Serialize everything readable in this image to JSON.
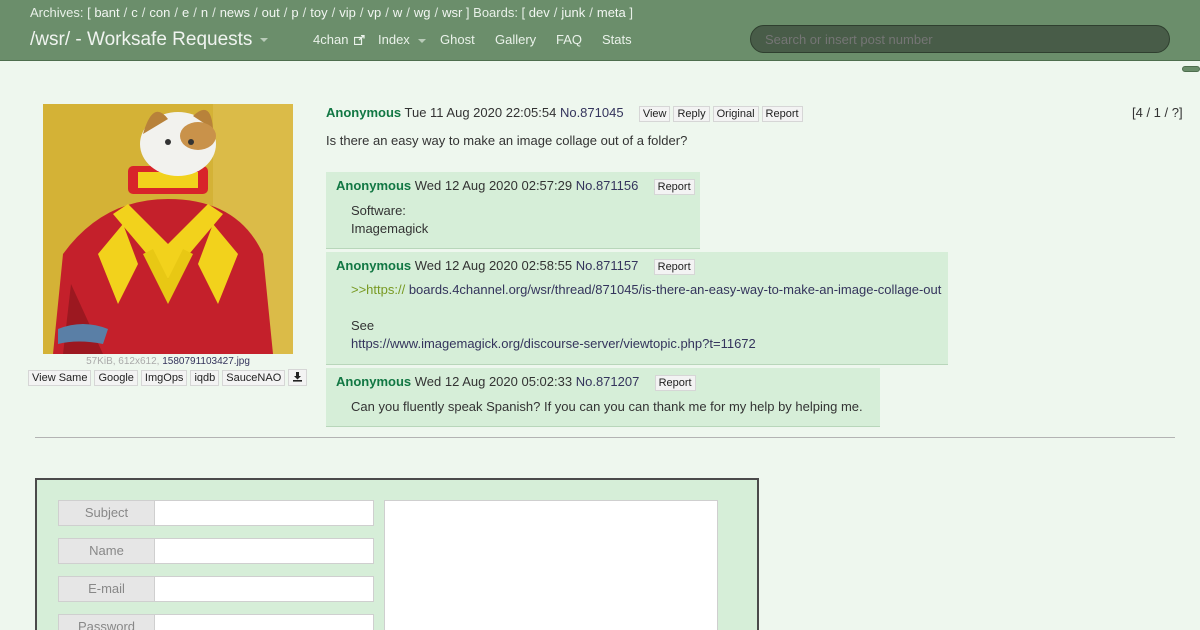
{
  "header": {
    "archives_label": "Archives: [",
    "archive_links": [
      "bant",
      "c",
      "con",
      "e",
      "n",
      "news",
      "out",
      "p",
      "toy",
      "vip",
      "vp",
      "w",
      "wg",
      "wsr"
    ],
    "boards_label": "] Boards: [",
    "board_links": [
      "dev",
      "junk",
      "meta"
    ],
    "boards_close": "]",
    "brand": "/wsr/ - Worksafe Requests",
    "nav": {
      "fourchan": "4chan",
      "index": "Index",
      "ghost": "Ghost",
      "gallery": "Gallery",
      "faq": "FAQ",
      "stats": "Stats"
    },
    "search_placeholder": "Search or insert post number"
  },
  "op": {
    "file_meta": "57KiB, 612x612,",
    "file_name": "1580791103427.jpg",
    "image_buttons": [
      "View Same",
      "Google",
      "ImgOps",
      "iqdb",
      "SauceNAO"
    ],
    "name": "Anonymous",
    "date": "Tue 11 Aug 2020 22:05:54",
    "number": "No.871045",
    "buttons": [
      "View",
      "Reply",
      "Original",
      "Report"
    ],
    "pager": "[4 / 1 / ?]",
    "text": "Is there an easy way to make an image collage out of a folder?"
  },
  "replies": [
    {
      "name": "Anonymous",
      "date": "Wed 12 Aug 2020 02:57:29",
      "number": "No.871156",
      "report": "Report",
      "lines": [
        "Software:",
        "Imagemagick"
      ]
    },
    {
      "name": "Anonymous",
      "date": "Wed 12 Aug 2020 02:58:55",
      "number": "No.871157",
      "report": "Report",
      "quote": ">>https://",
      "quote_rest": "boards.4channel.org/wsr/thread/871045/is-there-an-easy-way-to-make-an-image-collage-out",
      "see": "See",
      "link": "https://www.imagemagick.org/discourse-server/viewtopic.php?t=11672"
    },
    {
      "name": "Anonymous",
      "date": "Wed 12 Aug 2020 05:02:33",
      "number": "No.871207",
      "report": "Report",
      "lines": [
        "Can you fluently speak Spanish? If you can you can thank me for my help by helping me."
      ]
    }
  ],
  "form": {
    "labels": [
      "Subject",
      "Name",
      "E-mail",
      "Password"
    ]
  }
}
